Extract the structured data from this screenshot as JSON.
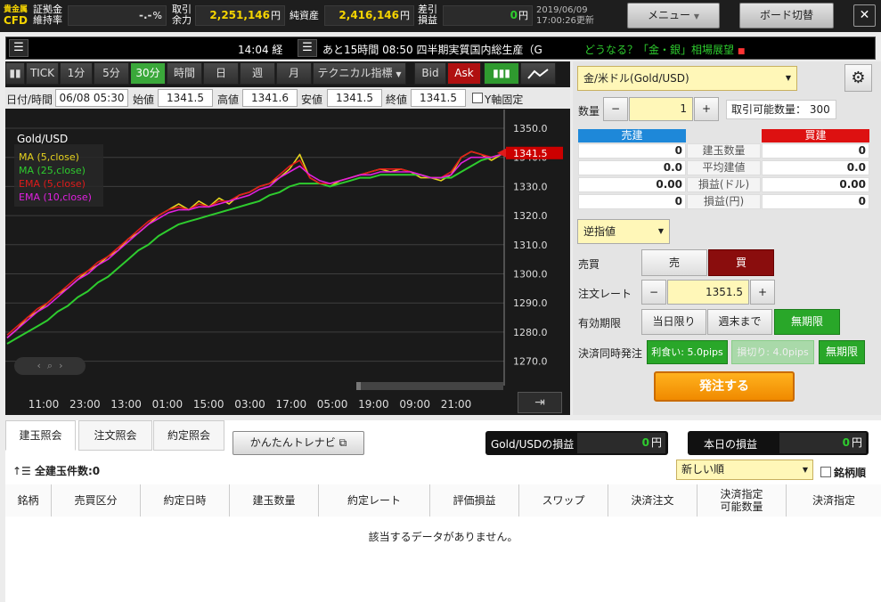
{
  "topbar": {
    "logo_top": "貴金属",
    "logo_bottom": "CFD",
    "l1a": "証拠金",
    "l1b": "維持率",
    "v1": "-.-",
    "v1u": "%",
    "l2a": "取引",
    "l2b": "余力",
    "v2": "2,251,146",
    "v2u": "円",
    "l3": "純資産",
    "v3": "2,416,146",
    "v3u": "円",
    "l4a": "差引",
    "l4b": "損益",
    "v4": "0",
    "v4u": "円",
    "date": "2019/06/09",
    "time": "17:00:26更新",
    "menu_btn": "メニュー",
    "board_btn": "ボード切替",
    "close": "✕"
  },
  "ticker": {
    "left_text": "14:04 経",
    "middle_text": "あと15時間 08:50 四半期実質国内総生産（G",
    "right_text": "どうなる？「金・銀」相場展望"
  },
  "chart_toolbar": {
    "items": [
      "TICK",
      "1分",
      "5分",
      "30分",
      "時間",
      "日",
      "週",
      "月"
    ],
    "indicator": "テクニカル指標",
    "bid": "Bid",
    "ask": "Ask"
  },
  "info": {
    "dt_label": "日付/時間",
    "dt": "06/08 05:30",
    "open_label": "始値",
    "open": "1341.5",
    "high_label": "高値",
    "high": "1341.6",
    "low_label": "安値",
    "low": "1341.5",
    "close_label": "終値",
    "close": "1341.5",
    "yfix": "Y軸固定"
  },
  "chart_data": {
    "type": "line",
    "title": "Gold/USD",
    "legend": [
      {
        "name": "MA (5,close)",
        "color": "#e6d21e"
      },
      {
        "name": "MA (25,close)",
        "color": "#2ecc2e"
      },
      {
        "name": "EMA (5,close)",
        "color": "#e01b1b"
      },
      {
        "name": "EMA (10,close)",
        "color": "#e020e0"
      }
    ],
    "x_ticks": [
      "11:00",
      "23:00",
      "13:00",
      "01:00",
      "15:00",
      "03:00",
      "17:00",
      "05:00",
      "19:00",
      "09:00",
      "21:00"
    ],
    "y_ticks": [
      1350.0,
      1340.0,
      1330.0,
      1320.0,
      1310.0,
      1300.0,
      1290.0,
      1280.0,
      1270.0
    ],
    "ylim": [
      1264,
      1356
    ],
    "price_line": 1341.5,
    "current_label": "1341.5",
    "series": [
      {
        "name": "MA (5,close)",
        "color": "#e6d21e",
        "values": [
          1278,
          1281,
          1285,
          1287,
          1290,
          1293,
          1295,
          1298,
          1301,
          1303,
          1306,
          1308,
          1312,
          1314,
          1317,
          1320,
          1322,
          1324,
          1322,
          1325,
          1323,
          1326,
          1324,
          1327,
          1328,
          1330,
          1331,
          1333,
          1336,
          1341,
          1333,
          1331,
          1330,
          1332,
          1333,
          1334,
          1335,
          1336,
          1335,
          1336,
          1335,
          1333,
          1333,
          1332,
          1334,
          1340,
          1342,
          1341,
          1339,
          1341
        ]
      },
      {
        "name": "MA (25,close)",
        "color": "#2ecc2e",
        "values": [
          1276,
          1278,
          1280,
          1282,
          1284,
          1287,
          1289,
          1292,
          1294,
          1297,
          1299,
          1302,
          1305,
          1308,
          1310,
          1313,
          1315,
          1317,
          1318,
          1319,
          1320,
          1321,
          1322,
          1323,
          1324,
          1325,
          1327,
          1328,
          1330,
          1331,
          1331,
          1331,
          1330,
          1331,
          1332,
          1333,
          1333,
          1334,
          1334,
          1334,
          1334,
          1334,
          1333,
          1333,
          1333,
          1335,
          1337,
          1339,
          1340,
          1341
        ]
      },
      {
        "name": "EMA (5,close)",
        "color": "#e01b1b",
        "values": [
          1279,
          1282,
          1285,
          1288,
          1290,
          1293,
          1296,
          1299,
          1301,
          1304,
          1306,
          1309,
          1312,
          1315,
          1318,
          1320,
          1322,
          1323,
          1322,
          1324,
          1323,
          1325,
          1325,
          1327,
          1328,
          1330,
          1331,
          1334,
          1337,
          1339,
          1333,
          1331,
          1331,
          1332,
          1333,
          1334,
          1335,
          1336,
          1336,
          1336,
          1335,
          1334,
          1333,
          1333,
          1335,
          1340,
          1342,
          1341,
          1340,
          1341
        ]
      },
      {
        "name": "EMA (10,close)",
        "color": "#e020e0",
        "values": [
          1278,
          1281,
          1284,
          1287,
          1289,
          1292,
          1295,
          1298,
          1300,
          1303,
          1305,
          1308,
          1311,
          1314,
          1317,
          1319,
          1321,
          1322,
          1322,
          1323,
          1323,
          1324,
          1325,
          1326,
          1327,
          1329,
          1330,
          1333,
          1335,
          1337,
          1334,
          1332,
          1331,
          1332,
          1333,
          1334,
          1334,
          1335,
          1335,
          1335,
          1335,
          1334,
          1333,
          1333,
          1334,
          1338,
          1340,
          1340,
          1340,
          1341
        ]
      }
    ]
  },
  "order": {
    "symbol": "金/米ドル(Gold/USD)",
    "qty_label": "数量",
    "qty": "1",
    "tradable_label": "取引可能数量：",
    "tradable": "300",
    "sell_head": "売建",
    "buy_head": "買建",
    "rows": [
      {
        "label": "建玉数量",
        "sell": "0",
        "buy": "0"
      },
      {
        "label": "平均建値",
        "sell": "0.0",
        "buy": "0.0"
      },
      {
        "label": "損益(ドル)",
        "sell": "0.00",
        "buy": "0.00"
      },
      {
        "label": "損益(円)",
        "sell": "0",
        "buy": "0"
      }
    ],
    "order_type": "逆指値",
    "side_label": "売買",
    "sell": "売",
    "buy": "買",
    "rate_label": "注文レート",
    "rate": "1351.5",
    "expiry_label": "有効期限",
    "exp1": "当日限り",
    "exp2": "週末まで",
    "exp3": "無期限",
    "settle_label": "決済同時発注",
    "tp": "利食い: 5.0pips",
    "sl": "損切り: 4.0pips",
    "settle_exp": "無期限",
    "submit": "発注する"
  },
  "bottom": {
    "tabs": [
      "建玉照会",
      "注文照会",
      "約定照会"
    ],
    "navi": "かんたんトレナビ",
    "pl_label": "Gold/USDの損益",
    "pl_val": "0",
    "pl_unit": "円",
    "today_label": "本日の損益",
    "today_val": "0",
    "today_unit": "円",
    "count_label": "全建玉件数:0",
    "sort": "新しい順",
    "brand_sort": "銘柄順",
    "columns": [
      "銘柄",
      "売買区分",
      "約定日時",
      "建玉数量",
      "約定レート",
      "評価損益",
      "スワップ",
      "決済注文",
      "決済指定\n可能数量",
      "決済指定"
    ],
    "empty": "該当するデータがありません。"
  }
}
